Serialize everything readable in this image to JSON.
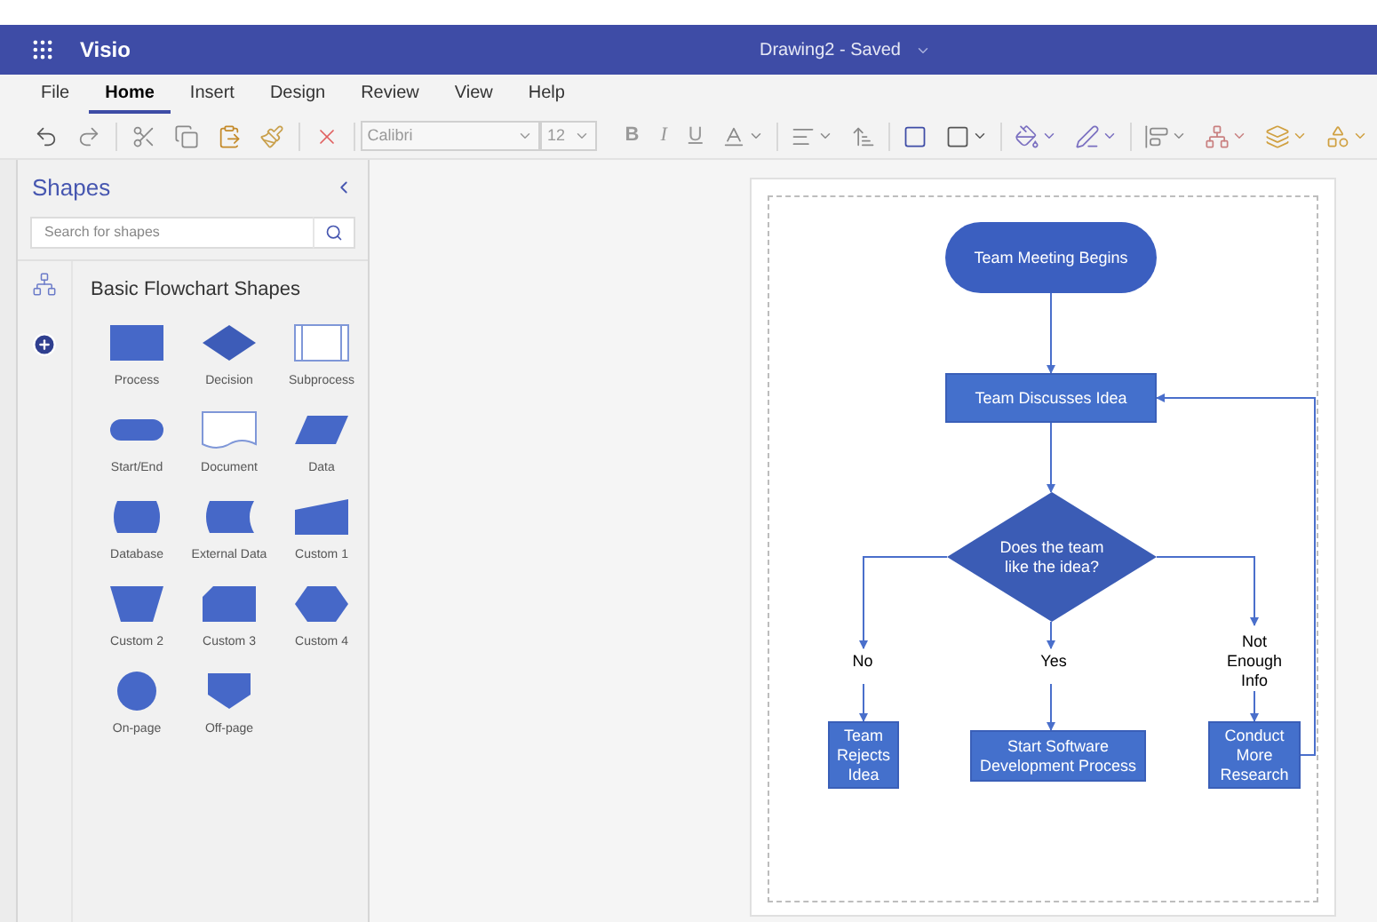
{
  "app": {
    "name": "Visio",
    "document_title": "Drawing2 - Saved"
  },
  "menu": [
    {
      "label": "File",
      "selected": false
    },
    {
      "label": "Home",
      "selected": true
    },
    {
      "label": "Insert",
      "selected": false
    },
    {
      "label": "Design",
      "selected": false
    },
    {
      "label": "Review",
      "selected": false
    },
    {
      "label": "View",
      "selected": false
    },
    {
      "label": "Help",
      "selected": false
    }
  ],
  "toolbar": {
    "font": "Calibri",
    "size": "12",
    "bold": "B",
    "italic": "I",
    "underline": "U"
  },
  "shapes_panel": {
    "title": "Shapes",
    "search_placeholder": "Search for shapes",
    "stencil_title": "Basic Flowchart Shapes",
    "shapes": [
      {
        "name": "Process",
        "kind": "process"
      },
      {
        "name": "Decision",
        "kind": "decision"
      },
      {
        "name": "Subprocess",
        "kind": "subprocess"
      },
      {
        "name": "Start/End",
        "kind": "terminator"
      },
      {
        "name": "Document",
        "kind": "document"
      },
      {
        "name": "Data",
        "kind": "data"
      },
      {
        "name": "Database",
        "kind": "database"
      },
      {
        "name": "External Data",
        "kind": "external"
      },
      {
        "name": "Custom 1",
        "kind": "custom1"
      },
      {
        "name": "Custom 2",
        "kind": "custom2"
      },
      {
        "name": "Custom 3",
        "kind": "custom3"
      },
      {
        "name": "Custom 4",
        "kind": "custom4"
      },
      {
        "name": "On-page",
        "kind": "onpage"
      },
      {
        "name": "Off-page",
        "kind": "offpage"
      }
    ]
  },
  "diagram": {
    "nodes": [
      {
        "kind": "terminator",
        "text": "Team Meeting Begins"
      },
      {
        "kind": "process",
        "text": "Team Discusses Idea"
      },
      {
        "kind": "decision",
        "text": "Does the team like the idea?"
      },
      {
        "kind": "process",
        "text": "Team Rejects Idea"
      },
      {
        "kind": "process",
        "text": "Start Software Development Process"
      },
      {
        "kind": "process",
        "text": "Conduct More Research"
      }
    ],
    "labels": [
      "No",
      "Yes",
      "Not Enough Info"
    ]
  }
}
